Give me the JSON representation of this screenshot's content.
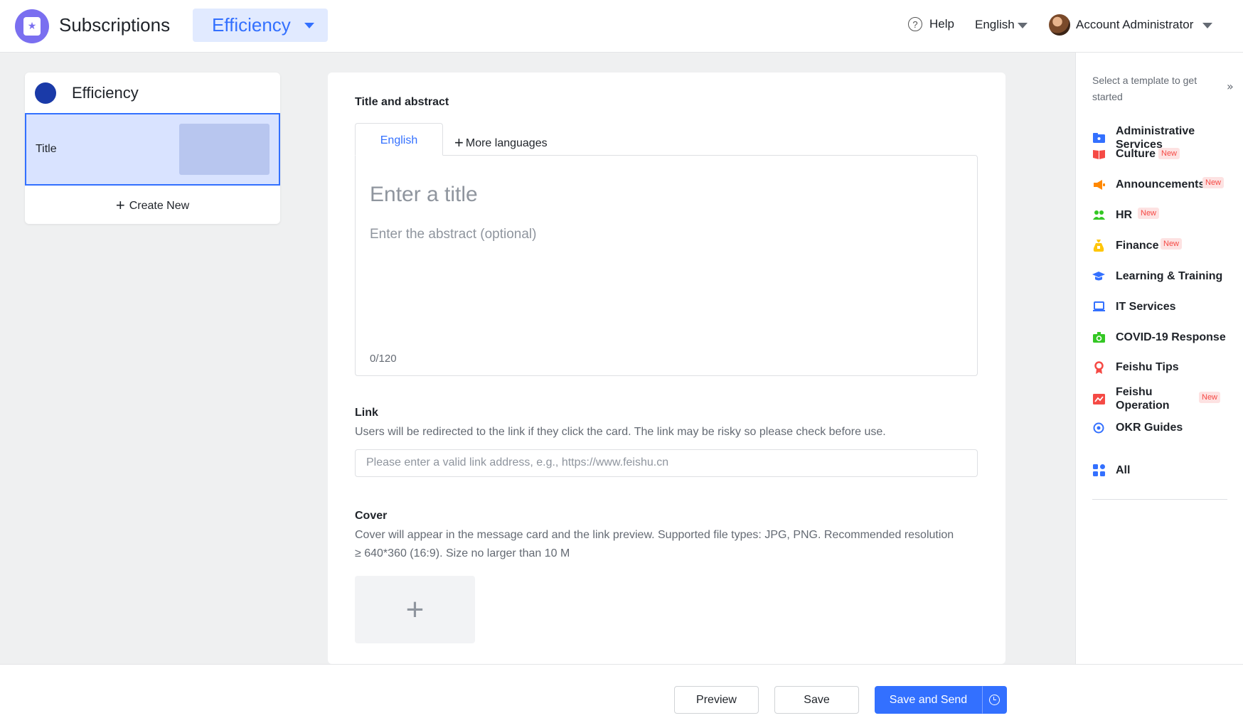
{
  "header": {
    "app_title": "Subscriptions",
    "channel": "Efficiency",
    "help": "Help",
    "language": "English",
    "account": "Account Administrator"
  },
  "sidebar": {
    "channel_name": "Efficiency",
    "selected_item_label": "Title",
    "create_new": "Create New"
  },
  "editor": {
    "title_section": "Title and abstract",
    "tabs": [
      "English",
      "More languages"
    ],
    "title_placeholder": "Enter a title",
    "abstract_placeholder": "Enter the abstract (optional)",
    "char_count": "0/120",
    "link_label": "Link",
    "link_description": "Users will be redirected to the link if they click the card. The link may be risky so please check before use.",
    "link_placeholder": "Please enter a valid link address, e.g., https://www.feishu.cn",
    "cover_label": "Cover",
    "cover_description_1": "Cover will appear in the message card and the link preview. Supported file types: JPG, PNG. Recommended resolution",
    "cover_description_2": "≥ 640*360 (16:9). Size no larger than 10 M"
  },
  "templates": {
    "title": "Select a template to get started",
    "new_badge": "New",
    "items": [
      {
        "label": "Administrative Services",
        "icon": "folder-icon",
        "color": "#3370ff",
        "new": false
      },
      {
        "label": "Culture",
        "icon": "book-icon",
        "color": "#f54a45",
        "new": true
      },
      {
        "label": "Announcements",
        "icon": "megaphone-icon",
        "color": "#ff8800",
        "new": true
      },
      {
        "label": "HR",
        "icon": "people-icon",
        "color": "#34c724",
        "new": true
      },
      {
        "label": "Finance",
        "icon": "money-bag-icon",
        "color": "#ffc60a",
        "new": true
      },
      {
        "label": "Learning & Training",
        "icon": "graduation-cap-icon",
        "color": "#3370ff",
        "new": false
      },
      {
        "label": "IT Services",
        "icon": "laptop-icon",
        "color": "#3370ff",
        "new": false
      },
      {
        "label": "COVID-19 Response",
        "icon": "medical-kit-icon",
        "color": "#34c724",
        "new": false
      },
      {
        "label": "Feishu Tips",
        "icon": "award-icon",
        "color": "#f54a45",
        "new": false
      },
      {
        "label": "Feishu Operation",
        "icon": "chart-icon",
        "color": "#f54a45",
        "new": true
      },
      {
        "label": "OKR Guides",
        "icon": "target-icon",
        "color": "#3370ff",
        "new": false
      }
    ],
    "all": "All"
  },
  "footer": {
    "preview": "Preview",
    "save": "Save",
    "save_and_send": "Save and Send"
  }
}
